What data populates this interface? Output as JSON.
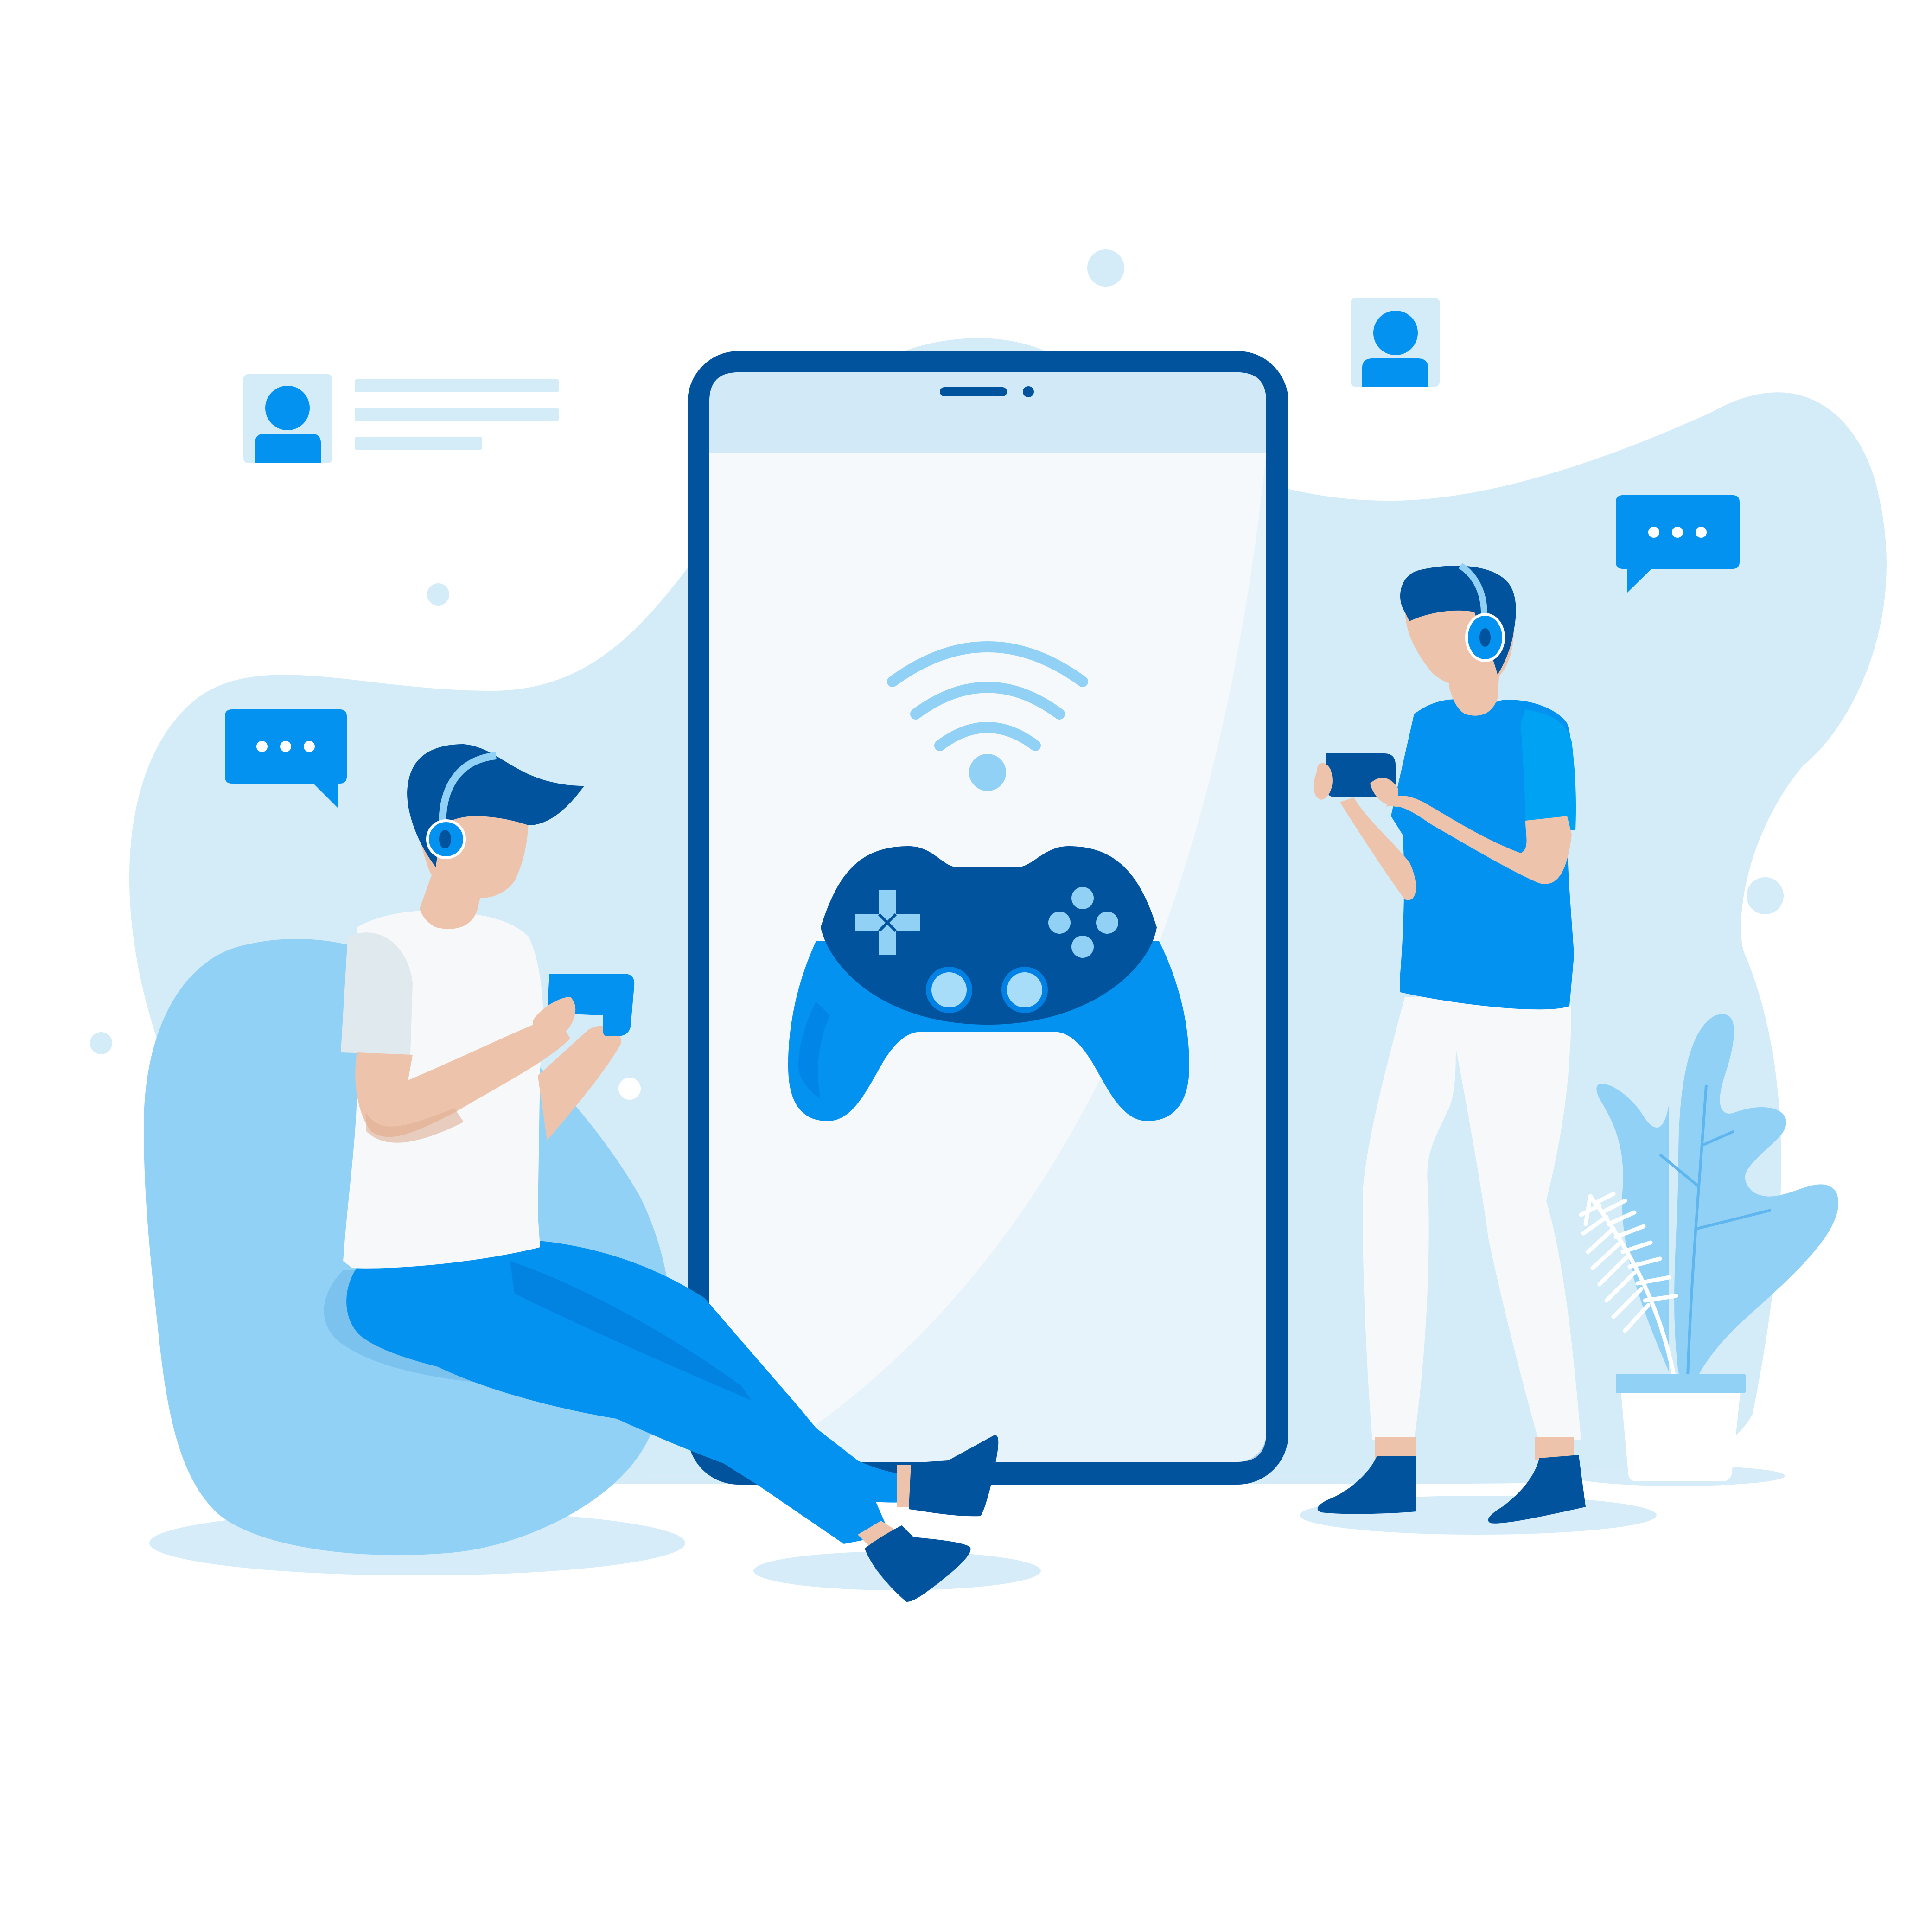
{
  "scene": {
    "background": "#ffffff",
    "colors": {
      "blob": "#d4ebf8",
      "blob_light": "#e4f2fb",
      "light_blue": "#92d1f6",
      "primary_blue": "#0392f0",
      "bright_blue": "#00a2f4",
      "navy": "#00539c",
      "phone_screen": "#f6f9fc",
      "phone_header": "#d2eaf8",
      "skin": "#edc4ab",
      "skin_shadow": "#e0af94",
      "white_cloth": "#f6f8fa",
      "shadow_ellipse": "#d6ecf9"
    },
    "icons": [
      "phone-icon",
      "game-controller-icon",
      "wifi-signal-icon",
      "user-profile-card-icon",
      "user-avatar-icon",
      "chat-bubble-icon",
      "headphones-icon",
      "plant-icon"
    ],
    "chat_bubble_text": "• • •"
  }
}
